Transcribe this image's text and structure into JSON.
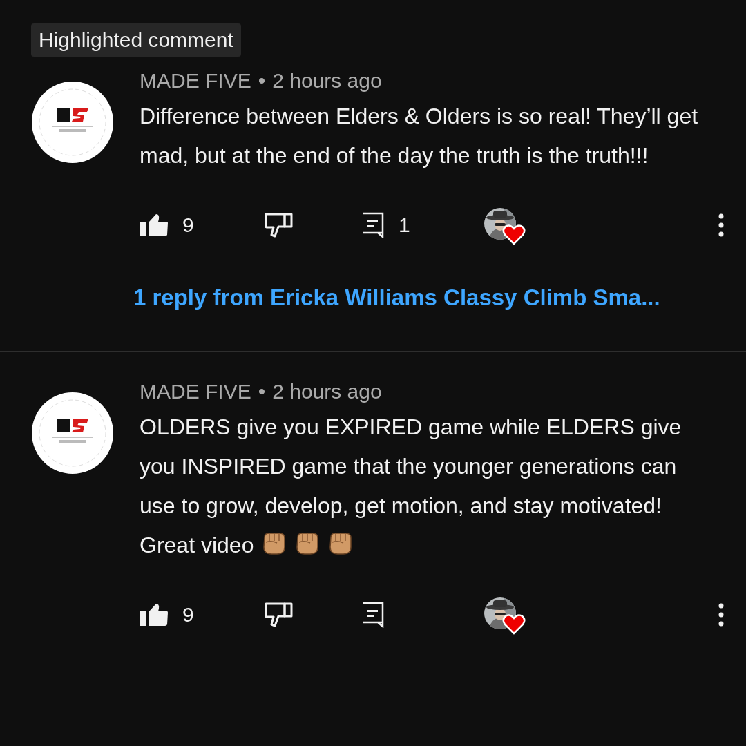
{
  "badge": "Highlighted comment",
  "comments": [
    {
      "author": "MADE FIVE",
      "separator": "•",
      "time": "2 hours ago",
      "text": "Difference between Elders & Olders is so real! They’ll get mad, but at the end of the day the truth is the truth!!!",
      "likes": "9",
      "liked": true,
      "disliked": false,
      "replies": "1",
      "creator_hearted": true,
      "reply_link": "1 reply from Ericka Williams Classy Climb Sma..."
    },
    {
      "author": "MADE FIVE",
      "separator": "•",
      "time": "2 hours ago",
      "text": "OLDERS give you EXPIRED game while ELDERS give you INSPIRED game that the younger generations can use to grow, develop, get motion, and stay motivated! Great video",
      "emoji": [
        {
          "kind": "fist"
        },
        {
          "kind": "fist"
        },
        {
          "kind": "fist"
        }
      ],
      "likes": "9",
      "liked": true,
      "disliked": false,
      "creator_hearted": true
    }
  ]
}
